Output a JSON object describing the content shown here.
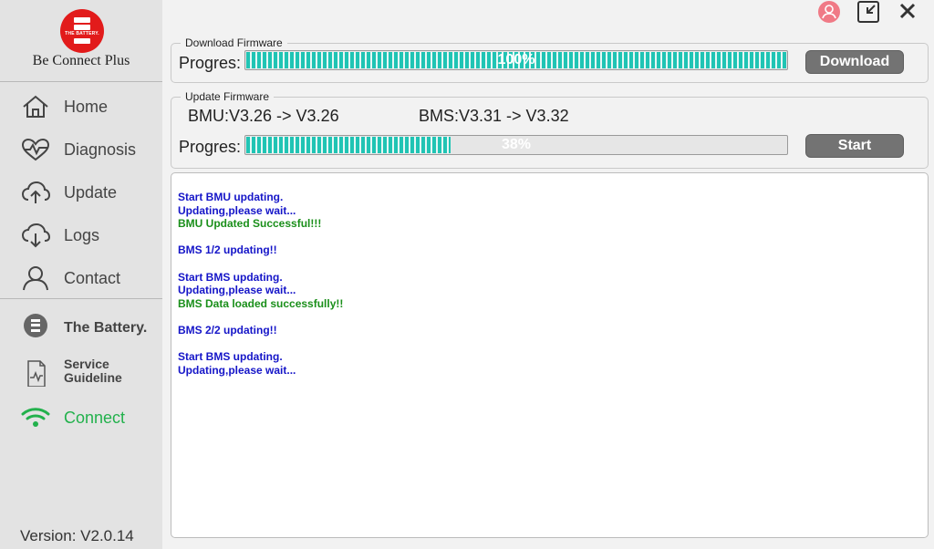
{
  "app": {
    "brand": "Be Connect Plus",
    "logo_text": "THE BATTERY.",
    "version": "Version: V2.0.14"
  },
  "sidebar": {
    "items": [
      {
        "label": "Home",
        "icon": "home-icon"
      },
      {
        "label": "Diagnosis",
        "icon": "heart-pulse-icon"
      },
      {
        "label": "Update",
        "icon": "cloud-upload-icon"
      },
      {
        "label": "Logs",
        "icon": "cloud-download-icon"
      },
      {
        "label": "Contact",
        "icon": "user-icon"
      }
    ],
    "extras": {
      "battery_label": "The Battery.",
      "service_line1": "Service",
      "service_line2": "Guideline",
      "connect_label": "Connect"
    }
  },
  "download": {
    "group_title": "Download Firmware",
    "progress_label": "Progres:",
    "progress": 1.0,
    "progress_text": "100%",
    "button_label": "Download"
  },
  "update": {
    "group_title": "Update Firmware",
    "bmu_text": "BMU:V3.26 -> V3.26",
    "bms_text": "BMS:V3.31 -> V3.32",
    "progress_label": "Progres:",
    "progress": 0.38,
    "progress_text": "38%",
    "button_label": "Start"
  },
  "log": {
    "lines": [
      {
        "text": "Start BMU updating.",
        "color": "#1515c8"
      },
      {
        "text": "Updating,please wait...",
        "color": "#1515c8"
      },
      {
        "text": "BMU Updated Successful!!!",
        "color": "#1a8f1a"
      },
      {
        "text": "",
        "color": "#1515c8"
      },
      {
        "text": "BMS 1/2 updating!!",
        "color": "#1515c8"
      },
      {
        "text": "",
        "color": "#1515c8"
      },
      {
        "text": "Start BMS updating.",
        "color": "#1515c8"
      },
      {
        "text": "Updating,please wait...",
        "color": "#1515c8"
      },
      {
        "text": "BMS Data loaded successfully!!",
        "color": "#1a8f1a"
      },
      {
        "text": "",
        "color": "#1515c8"
      },
      {
        "text": "BMS 2/2 updating!!",
        "color": "#1515c8"
      },
      {
        "text": "",
        "color": "#1515c8"
      },
      {
        "text": "Start BMS updating.",
        "color": "#1515c8"
      },
      {
        "text": "Updating,please wait...",
        "color": "#1515c8"
      }
    ]
  },
  "colors": {
    "accent": "#20c4b4",
    "connect": "#22b14c",
    "brand_red": "#e21b1b"
  }
}
